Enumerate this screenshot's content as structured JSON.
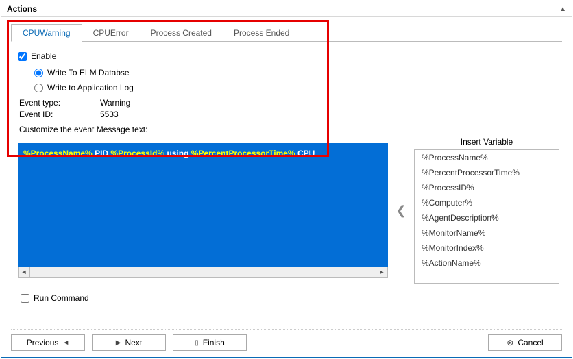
{
  "panel": {
    "title": "Actions"
  },
  "tabs": [
    {
      "label": "CPUWarning",
      "active": true
    },
    {
      "label": "CPUError"
    },
    {
      "label": "Process Created"
    },
    {
      "label": "Process Ended"
    }
  ],
  "form": {
    "enable_label": "Enable",
    "enable_checked": true,
    "radio_elm_label": "Write To ELM Databse",
    "radio_elm_selected": true,
    "radio_applog_label": "Write to Application Log",
    "radio_applog_selected": false,
    "event_type_label": "Event type:",
    "event_type_value": "Warning",
    "event_id_label": "Event ID:",
    "event_id_value": "5533"
  },
  "customize_label": "Customize the event Message text:",
  "message_parts": [
    {
      "kind": "var",
      "text": "%ProcessName%"
    },
    {
      "kind": "txt",
      "text": " PID "
    },
    {
      "kind": "var",
      "text": "%ProcessId%"
    },
    {
      "kind": "txt",
      "text": " using "
    },
    {
      "kind": "var",
      "text": "%PercentProcessorTime%"
    },
    {
      "kind": "txt",
      "text": " CPU"
    }
  ],
  "insert_variable_title": "Insert Variable",
  "variables": [
    "%ProcessName%",
    "%PercentProcessorTime%",
    "%ProcessID%",
    "%Computer%",
    "%AgentDescription%",
    "%MonitorName%",
    "%MonitorIndex%",
    "%ActionName%"
  ],
  "run_command_label": "Run Command",
  "buttons": {
    "previous": "Previous",
    "next": "Next",
    "finish": "Finish",
    "cancel": "Cancel"
  }
}
